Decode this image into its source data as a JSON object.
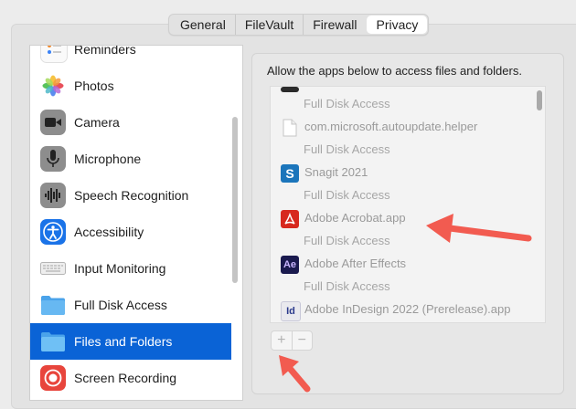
{
  "tabs": [
    "General",
    "FileVault",
    "Firewall",
    "Privacy"
  ],
  "active_tab": "Privacy",
  "sidebar": {
    "items": [
      {
        "label": "Reminders",
        "icon": "reminders-icon"
      },
      {
        "label": "Photos",
        "icon": "photos-icon"
      },
      {
        "label": "Camera",
        "icon": "camera-icon"
      },
      {
        "label": "Microphone",
        "icon": "microphone-icon"
      },
      {
        "label": "Speech Recognition",
        "icon": "speech-recognition-icon"
      },
      {
        "label": "Accessibility",
        "icon": "accessibility-icon"
      },
      {
        "label": "Input Monitoring",
        "icon": "keyboard-icon"
      },
      {
        "label": "Full Disk Access",
        "icon": "folder-icon"
      },
      {
        "label": "Files and Folders",
        "icon": "folder-icon"
      },
      {
        "label": "Screen Recording",
        "icon": "screen-recording-icon"
      }
    ],
    "selected": "Files and Folders"
  },
  "main": {
    "description": "Allow the apps below to access files and folders.",
    "apps": [
      {
        "name": "",
        "subtitle": "Full Disk Access",
        "icon": "app-icon"
      },
      {
        "name": "com.microsoft.autoupdate.helper",
        "subtitle": "Full Disk Access",
        "icon": "document-icon"
      },
      {
        "name": "Snagit 2021",
        "subtitle": "Full Disk Access",
        "icon": "snagit-icon"
      },
      {
        "name": "Adobe Acrobat.app",
        "subtitle": "Full Disk Access",
        "icon": "acrobat-icon"
      },
      {
        "name": "Adobe After Effects",
        "subtitle": "Full Disk Access",
        "icon": "after-effects-icon"
      },
      {
        "name": "Adobe InDesign 2022 (Prerelease).app",
        "subtitle": "",
        "icon": "indesign-icon"
      }
    ],
    "add_label": "+",
    "remove_label": "−"
  },
  "colors": {
    "selection": "#0a63d6",
    "annotation_arrow": "#f25b50",
    "background": "#ececec"
  }
}
